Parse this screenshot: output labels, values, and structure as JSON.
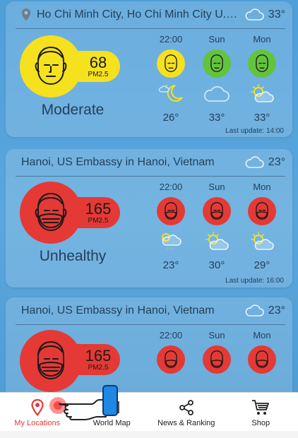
{
  "colors": {
    "moderate": "#f5e11e",
    "unhealthy": "#e53935",
    "good": "#63c33e",
    "text": "#24405a",
    "nav_active": "#e53935"
  },
  "cards": [
    {
      "location": "Ho Chi Minh City, Ho Chi Minh City U.S....",
      "header_temp": "33°",
      "header_weather_icon": "cloud-icon",
      "aqi": "68",
      "aqi_unit": "PM2.5",
      "level": "Moderate",
      "forecast": [
        {
          "label": "22:00",
          "face": "moderate-face-icon",
          "weather": "moon-cloud-icon",
          "temp": "26°"
        },
        {
          "label": "Sun",
          "face": "good-face-icon",
          "weather": "cloud-icon",
          "temp": "33°"
        },
        {
          "label": "Mon",
          "face": "good-face-icon",
          "weather": "sun-cloud-icon",
          "temp": "33°"
        }
      ],
      "last_update": "Last update: 14:00"
    },
    {
      "location": "Hanoi, US Embassy in Hanoi, Vietnam",
      "header_temp": "23°",
      "header_weather_icon": "cloud-icon",
      "aqi": "165",
      "aqi_unit": "PM2.5",
      "level": "Unhealthy",
      "forecast": [
        {
          "label": "22:00",
          "face": "mask-face-icon",
          "weather": "rain-sun-cloud-icon",
          "temp": "23°"
        },
        {
          "label": "Sun",
          "face": "mask-face-icon",
          "weather": "sun-cloud-icon",
          "temp": "30°"
        },
        {
          "label": "Mon",
          "face": "mask-face-icon",
          "weather": "sun-cloud-icon",
          "temp": "29°"
        }
      ],
      "last_update": "Last update: 16:00"
    },
    {
      "location": "Hanoi, US Embassy in Hanoi, Vietnam",
      "header_temp": "23°",
      "header_weather_icon": "cloud-icon",
      "aqi": "165",
      "aqi_unit": "PM2.5",
      "forecast": [
        {
          "label": "22:00",
          "face": "mask-face-icon"
        },
        {
          "label": "Sun",
          "face": "mask-face-icon"
        },
        {
          "label": "Mon",
          "face": "mask-face-icon"
        }
      ]
    }
  ],
  "nav": [
    {
      "label": "My Locations",
      "icon": "location-pin-icon",
      "active": true
    },
    {
      "label": "World Map",
      "icon": "map-icon",
      "active": false
    },
    {
      "label": "News & Ranking",
      "icon": "share-icon",
      "active": false
    },
    {
      "label": "Shop",
      "icon": "cart-icon",
      "active": false
    }
  ]
}
